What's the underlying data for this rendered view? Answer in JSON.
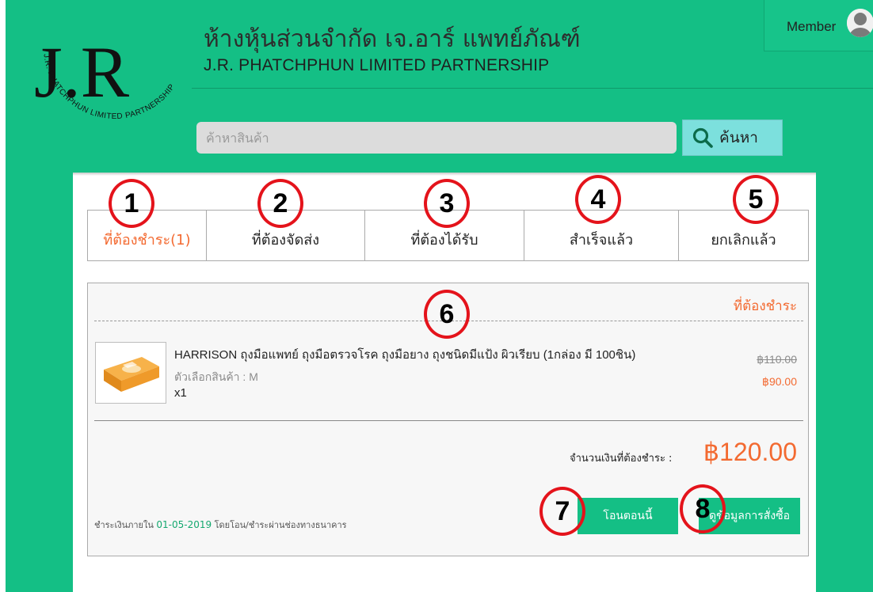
{
  "header": {
    "company_name_th": "ห้างหุ้นส่วนจำกัด เจ.อาร์ แพทย์ภัณฑ์",
    "company_name_en": "J.R. PHATCHPHUN LIMITED PARTNERSHIP",
    "logo_text": "J.R",
    "logo_ring_text": "J.R. PHATCHPHUN LIMITED PARTNERSHIP",
    "member_label": "Member",
    "avatar_icon": "user-icon"
  },
  "search": {
    "placeholder": "ค้าหาสินค้า",
    "button_label": "ค้นหา",
    "icon": "search-icon"
  },
  "tabs": [
    {
      "label": "ที่ต้องชำระ(1)",
      "active": true
    },
    {
      "label": "ที่ต้องจัดส่ง",
      "active": false
    },
    {
      "label": "ที่ต้องได้รับ",
      "active": false
    },
    {
      "label": "สำเร็จแล้ว",
      "active": false
    },
    {
      "label": "ยกเลิกแล้ว",
      "active": false
    }
  ],
  "order": {
    "status": "ที่ต้องชำระ",
    "product_name": "HARRISON ถุงมือแพทย์ ถุงมือตรวจโรค ถุงมือยาง ถุงชนิดมีแป้ง ผิวเรียบ (1กล่อง มี 100ชิน)",
    "product_option": "ตัวเลือกสินค้า : M",
    "quantity": "x1",
    "original_price": "฿110.00",
    "sale_price": "฿90.00",
    "total_label": "จำนวนเงินที่ต้องชำระ :",
    "total_value": "฿120.00",
    "payment_note_prefix": "ชำระเงินภายใน",
    "payment_due_date": "01-05-2019",
    "payment_note_suffix": "โดยโอน/ชำระผ่านช่องทางธนาคาร",
    "transfer_button": "โอนตอนนี้",
    "details_button": "ดูข้อมูลการสั่งซื้อ"
  },
  "markers": [
    "1",
    "2",
    "3",
    "4",
    "5",
    "6",
    "7",
    "8"
  ],
  "colors": {
    "brand_green": "#14bf85",
    "accent_orange": "#f36a31",
    "marker_red": "#e4131b",
    "search_button": "#7ce0dd"
  }
}
